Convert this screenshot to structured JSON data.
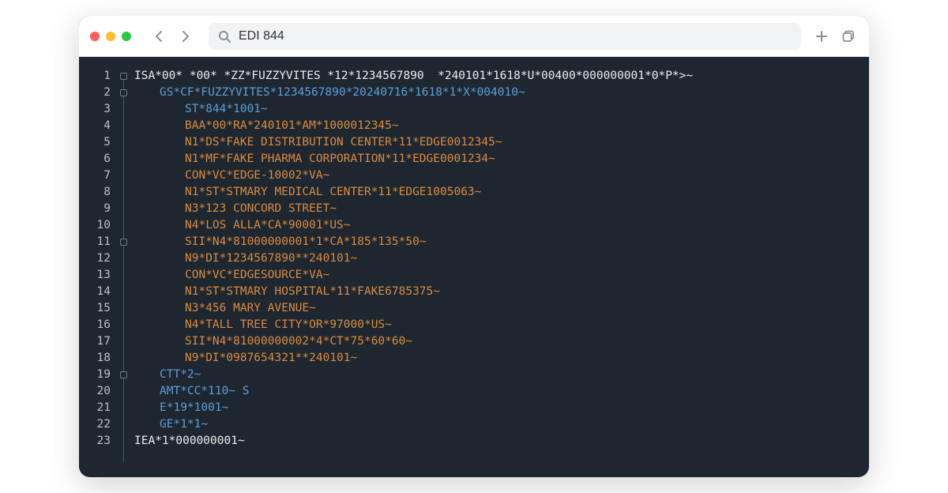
{
  "search": {
    "value": "EDI 844"
  },
  "editor": {
    "fold_markers_at": [
      1,
      2,
      11,
      19
    ],
    "lines": [
      {
        "n": 1,
        "indent": 0,
        "color": "white",
        "text": "ISA*00* *00* *ZZ*FUZZYVITES *12*1234567890  *240101*1618*U*00400*000000001*0*P*>~"
      },
      {
        "n": 2,
        "indent": 1,
        "color": "blue",
        "text": "GS*CF*FUZZYVITES*1234567890*20240716*1618*1*X*004010~"
      },
      {
        "n": 3,
        "indent": 2,
        "color": "blue",
        "text": "ST*844*1001~"
      },
      {
        "n": 4,
        "indent": 2,
        "color": "orange",
        "text": "BAA*00*RA*240101*AM*1000012345~"
      },
      {
        "n": 5,
        "indent": 2,
        "color": "orange",
        "text": "N1*DS*FAKE DISTRIBUTION CENTER*11*EDGE0012345~"
      },
      {
        "n": 6,
        "indent": 2,
        "color": "orange",
        "text": "N1*MF*FAKE PHARMA CORPORATION*11*EDGE0001234~"
      },
      {
        "n": 7,
        "indent": 2,
        "color": "orange",
        "text": "CON*VC*EDGE-10002*VA~"
      },
      {
        "n": 8,
        "indent": 2,
        "color": "orange",
        "text": "N1*ST*STMARY MEDICAL CENTER*11*EDGE1005063~"
      },
      {
        "n": 9,
        "indent": 2,
        "color": "orange",
        "text": "N3*123 CONCORD STREET~"
      },
      {
        "n": 10,
        "indent": 2,
        "color": "orange",
        "text": "N4*LOS ALLA*CA*90001*US~"
      },
      {
        "n": 11,
        "indent": 2,
        "color": "orange",
        "text": "SII*N4*81000000001*1*CA*185*135*50~"
      },
      {
        "n": 12,
        "indent": 2,
        "color": "orange",
        "text": "N9*DI*1234567890**240101~"
      },
      {
        "n": 13,
        "indent": 2,
        "color": "orange",
        "text": "CON*VC*EDGESOURCE*VA~"
      },
      {
        "n": 14,
        "indent": 2,
        "color": "orange",
        "text": "N1*ST*STMARY HOSPITAL*11*FAKE6785375~"
      },
      {
        "n": 15,
        "indent": 2,
        "color": "orange",
        "text": "N3*456 MARY AVENUE~"
      },
      {
        "n": 16,
        "indent": 2,
        "color": "orange",
        "text": "N4*TALL TREE CITY*OR*97000*US~"
      },
      {
        "n": 17,
        "indent": 2,
        "color": "orange",
        "text": "SII*N4*81000000002*4*CT*75*60*60~"
      },
      {
        "n": 18,
        "indent": 2,
        "color": "orange",
        "text": "N9*DI*0987654321**240101~"
      },
      {
        "n": 19,
        "indent": 1,
        "color": "blue",
        "text": "CTT*2~"
      },
      {
        "n": 20,
        "indent": 1,
        "color": "blue",
        "text": "AMT*CC*110~ S"
      },
      {
        "n": 21,
        "indent": 1,
        "color": "blue",
        "text": "E*19*1001~"
      },
      {
        "n": 22,
        "indent": 1,
        "color": "blue",
        "text": "GE*1*1~"
      },
      {
        "n": 23,
        "indent": 0,
        "color": "white",
        "text": "IEA*1*000000001~"
      }
    ]
  }
}
